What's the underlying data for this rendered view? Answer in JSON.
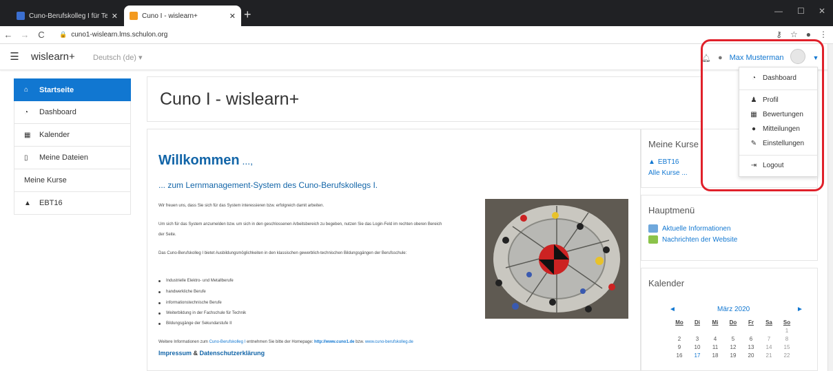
{
  "browser": {
    "tabs": [
      {
        "label": "Cuno-Berufskolleg I für Technik · ",
        "active": false
      },
      {
        "label": "Cuno I - wislearn+",
        "active": true
      }
    ],
    "new_tab": "+",
    "url": "cuno1-wislearn.lms.schulon.org"
  },
  "navbar": {
    "brand": "wislearn+",
    "language": "Deutsch (de) ▾",
    "user_name": "Max Musterman"
  },
  "sidebar": {
    "items": [
      {
        "label": "Startseite",
        "icon": "home-icon"
      },
      {
        "label": "Dashboard",
        "icon": "dashboard-icon"
      },
      {
        "label": "Kalender",
        "icon": "calendar-icon"
      },
      {
        "label": "Meine Dateien",
        "icon": "file-icon"
      },
      {
        "label": "Meine Kurse",
        "icon": ""
      },
      {
        "label": "EBT16",
        "icon": "graduation-cap-icon"
      }
    ]
  },
  "page": {
    "title": "Cuno I - wislearn+",
    "welcome": "Willkommen",
    "welcome_dots": " ...,",
    "subtitle": "... zum Lernmanagement-System des Cuno-Berufskollegs I.",
    "p1": "Wir freuen uns, dass Sie sich für das System interessieren bzw. erfolgreich damit arbeiten.",
    "p2": "Um sich für das System anzumelden bzw. um sich in den geschlossenen Arbeitsbereich zu begeben, nutzen Sie das Login-Feld im rechten oberen Bereich der Seite.",
    "p3": "Das Cuno-Berufskolleg I bietet Ausbildungsmöglichkeiten in den klassischen gewerblich-technischen Bildungsgängen der Berufsschule:",
    "bullets": [
      "Industrielle Elektro- und Metallberufe",
      "handwerkliche Berufe",
      "informationstechnische Berufe",
      "Weiterbildung in der Fachschule für Technik",
      "Bildungsgänge der Sekundarstufe II"
    ],
    "footer_prefix": "Weitere Informationen zum ",
    "footer_link1": "Cuno-Berufskolleg I",
    "footer_mid": " entnehmen Sie bitte der Homepage: ",
    "footer_link2": "http://www.cuno1.de",
    "footer_mid2": " bzw. ",
    "footer_link3": "www.cuno-berufskolleg.de",
    "impressum": "Impressum",
    "amp": " & ",
    "datenschutz": "Datenschutzerklärung"
  },
  "blocks": {
    "courses": {
      "title": "Meine Kurse",
      "course": "EBT16",
      "all": "Alle Kurse ..."
    },
    "mainmenu": {
      "title": "Hauptmenü",
      "items": [
        "Aktuelle Informationen",
        "Nachrichten der Website"
      ]
    },
    "calendar": {
      "title": "Kalender",
      "prev": "◄",
      "month": "März 2020",
      "next": "►",
      "weekdays": [
        "Mo",
        "Di",
        "Mi",
        "Do",
        "Fr",
        "Sa",
        "So"
      ],
      "days": [
        "",
        "",
        "",
        "",
        "",
        "",
        "1",
        "2",
        "3",
        "4",
        "5",
        "6",
        "7",
        "8",
        "9",
        "10",
        "11",
        "12",
        "13",
        "14",
        "15",
        "16",
        "17",
        "18",
        "19",
        "20",
        "21",
        "22"
      ],
      "today": "17"
    }
  },
  "user_menu": {
    "items": [
      {
        "label": "Dashboard",
        "icon": "dashboard-icon"
      },
      {
        "label": "Profil",
        "icon": "user-icon"
      },
      {
        "label": "Bewertungen",
        "icon": "table-icon"
      },
      {
        "label": "Mitteilungen",
        "icon": "chat-icon"
      },
      {
        "label": "Einstellungen",
        "icon": "wrench-icon"
      },
      {
        "label": "Logout",
        "icon": "logout-icon"
      }
    ]
  },
  "colors": {
    "accent": "#1177d1",
    "highlight": "#e0202a",
    "heading": "#1265a8"
  }
}
